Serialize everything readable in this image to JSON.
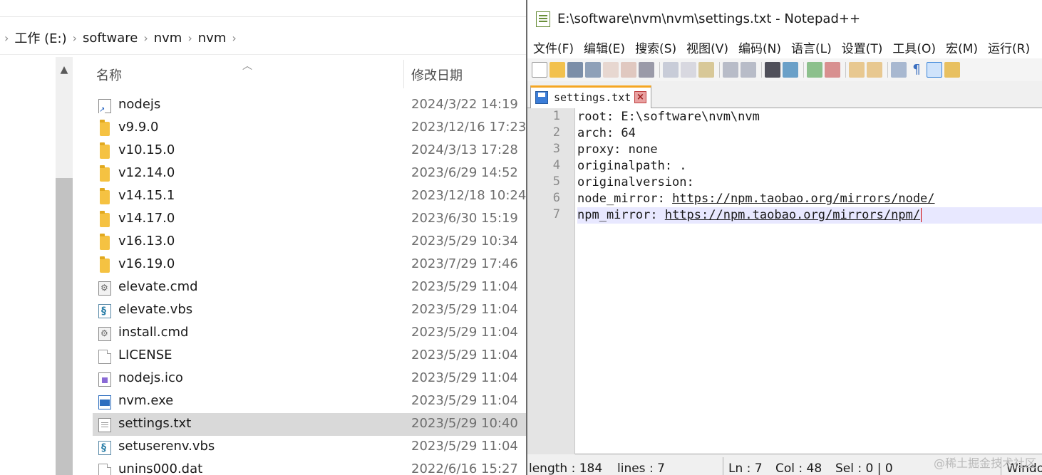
{
  "explorer": {
    "breadcrumb": [
      "工作 (E:)",
      "software",
      "nvm",
      "nvm"
    ],
    "columns": {
      "name": "名称",
      "date_modified": "修改日期"
    },
    "files": [
      {
        "name": "nodejs",
        "date": "2024/3/22 14:19",
        "icon": "shortcut-icon",
        "type": "shortcut"
      },
      {
        "name": "v9.9.0",
        "date": "2023/12/16 17:23",
        "icon": "folder-icon",
        "type": "folder"
      },
      {
        "name": "v10.15.0",
        "date": "2024/3/13 17:28",
        "icon": "folder-icon",
        "type": "folder"
      },
      {
        "name": "v12.14.0",
        "date": "2023/6/29 14:52",
        "icon": "folder-icon",
        "type": "folder"
      },
      {
        "name": "v14.15.1",
        "date": "2023/12/18 10:24",
        "icon": "folder-icon",
        "type": "folder"
      },
      {
        "name": "v14.17.0",
        "date": "2023/6/30 15:19",
        "icon": "folder-icon",
        "type": "folder"
      },
      {
        "name": "v16.13.0",
        "date": "2023/5/29 10:34",
        "icon": "folder-icon",
        "type": "folder"
      },
      {
        "name": "v16.19.0",
        "date": "2023/7/29 17:46",
        "icon": "folder-icon",
        "type": "folder"
      },
      {
        "name": "elevate.cmd",
        "date": "2023/5/29 11:04",
        "icon": "cmd-file-icon",
        "type": "cmd"
      },
      {
        "name": "elevate.vbs",
        "date": "2023/5/29 11:04",
        "icon": "vbs-script-icon",
        "type": "vbs"
      },
      {
        "name": "install.cmd",
        "date": "2023/5/29 11:04",
        "icon": "cmd-file-icon",
        "type": "cmd"
      },
      {
        "name": "LICENSE",
        "date": "2023/5/29 11:04",
        "icon": "blank-file-icon",
        "type": "file"
      },
      {
        "name": "nodejs.ico",
        "date": "2023/5/29 11:04",
        "icon": "ico-file-icon",
        "type": "ico"
      },
      {
        "name": "nvm.exe",
        "date": "2023/5/29 11:04",
        "icon": "exe-file-icon",
        "type": "exe"
      },
      {
        "name": "settings.txt",
        "date": "2023/5/29 10:40",
        "icon": "text-file-icon",
        "type": "txt",
        "selected": true
      },
      {
        "name": "setuserenv.vbs",
        "date": "2023/5/29 11:04",
        "icon": "vbs-script-icon",
        "type": "vbs"
      },
      {
        "name": "unins000.dat",
        "date": "2022/6/16 15:27",
        "icon": "blank-file-icon",
        "type": "file"
      }
    ]
  },
  "notepad": {
    "title": "E:\\software\\nvm\\nvm\\settings.txt - Notepad++",
    "menu": [
      "文件(F)",
      "编辑(E)",
      "搜索(S)",
      "视图(V)",
      "编码(N)",
      "语言(L)",
      "设置(T)",
      "工具(O)",
      "宏(M)",
      "运行(R)"
    ],
    "tab_label": "settings.txt",
    "lines": [
      {
        "n": "1",
        "text": "root: E:\\software\\nvm\\nvm"
      },
      {
        "n": "2",
        "text": "arch: 64"
      },
      {
        "n": "3",
        "text": "proxy: none"
      },
      {
        "n": "4",
        "text": "originalpath: ."
      },
      {
        "n": "5",
        "text": "originalversion:"
      },
      {
        "n": "6",
        "prefix": "node_mirror: ",
        "url": "https://npm.taobao.org/mirrors/node/"
      },
      {
        "n": "7",
        "prefix": "npm_mirror: ",
        "url": "https://npm.taobao.org/mirrors/npm/",
        "current": true
      }
    ],
    "status": {
      "length": "length : 184",
      "lines": "lines : 7",
      "ln": "Ln : 7",
      "col": "Col : 48",
      "sel": "Sel : 0 | 0",
      "eol": "Windo"
    }
  },
  "watermark": "@稀土掘金技术社区",
  "colors": {
    "selected_row": "#d9d9d9",
    "folder": "#f5c242",
    "current_line": "#e8e8ff",
    "tab_accent": "#f5a623",
    "caret": "#d00000"
  }
}
